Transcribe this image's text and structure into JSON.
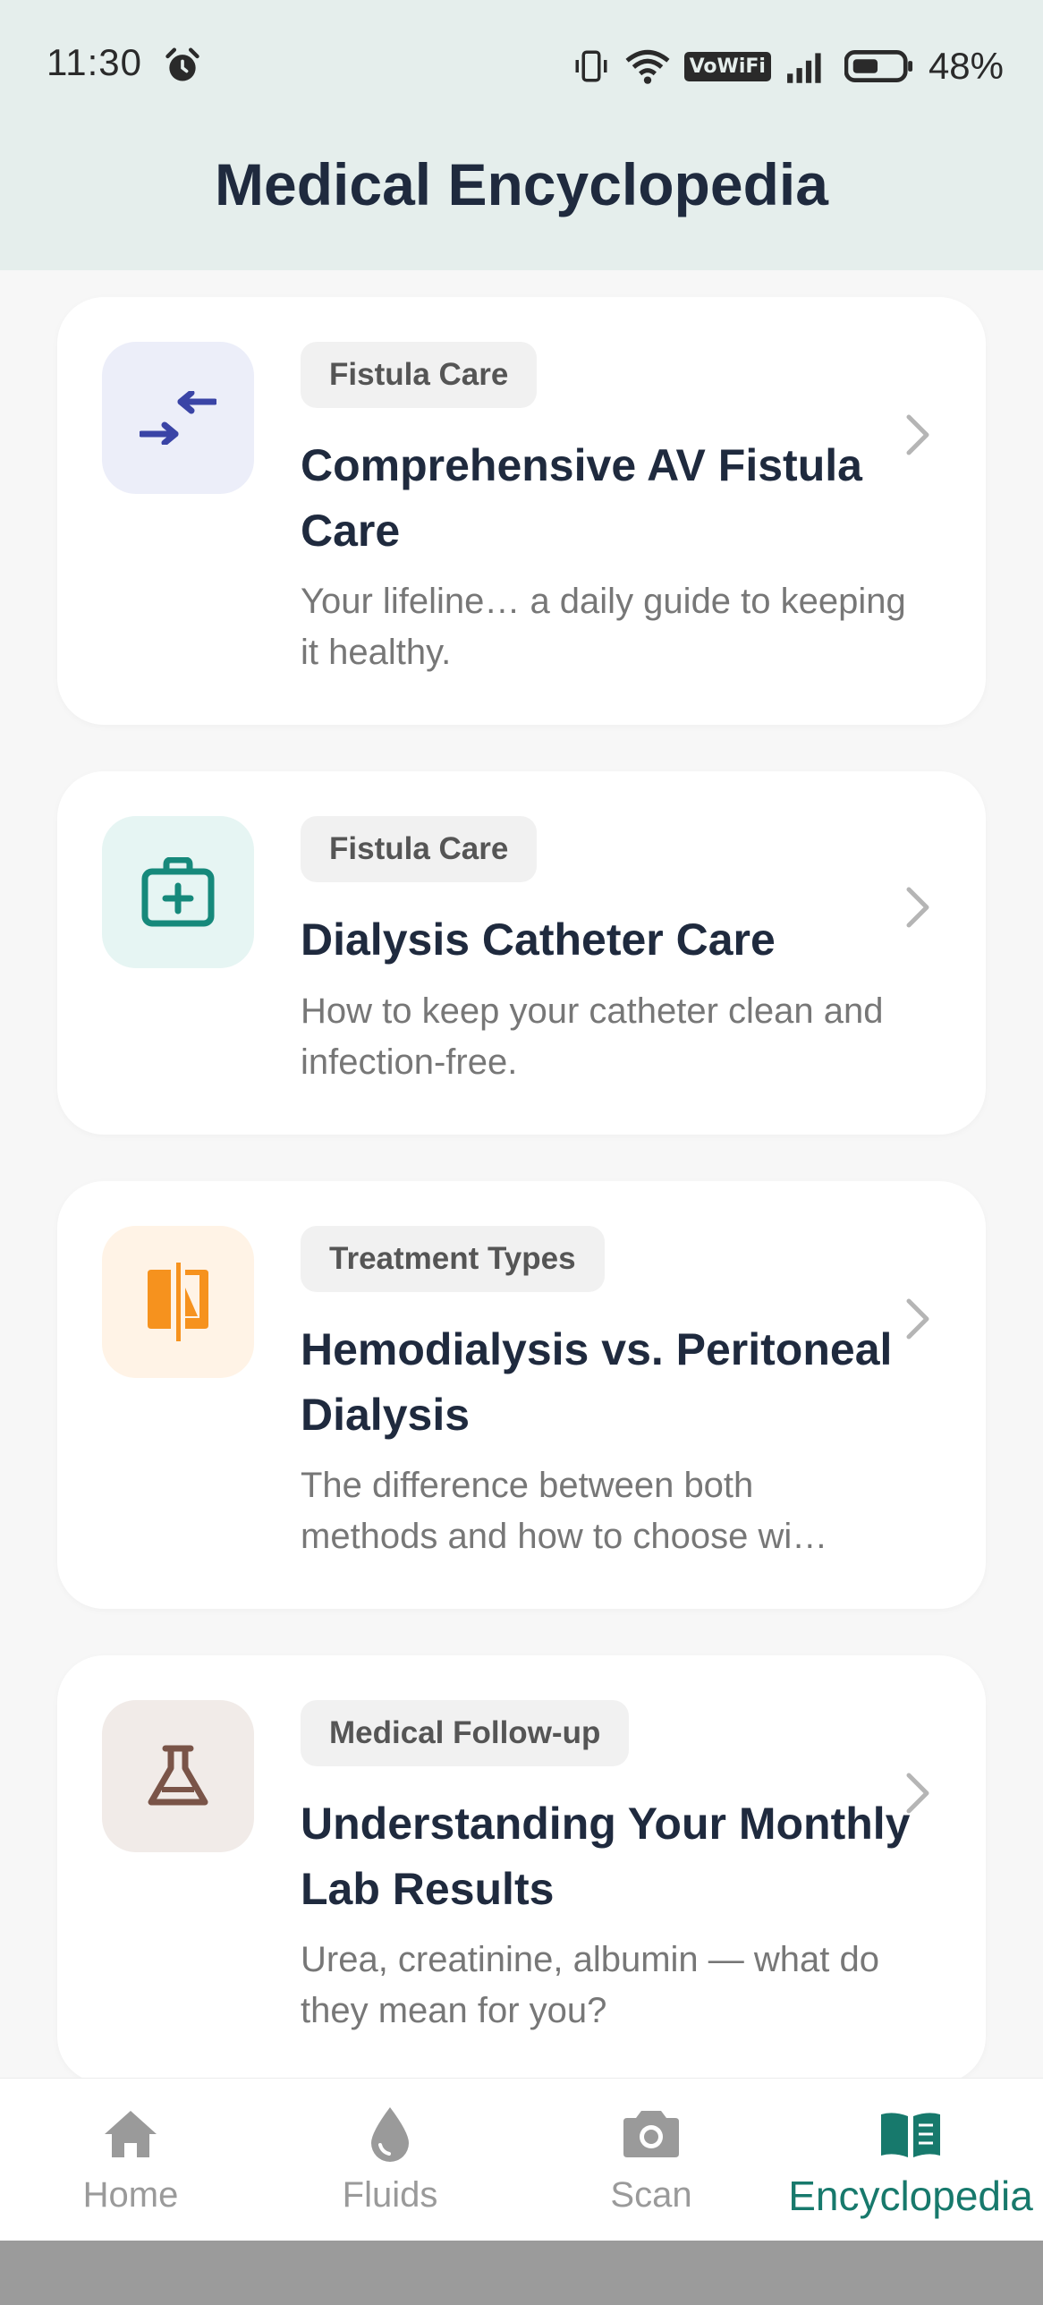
{
  "status_bar": {
    "time": "11:30",
    "wifi_badge": "VoWiFi",
    "battery_percent": "48%",
    "icons": [
      "alarm-icon",
      "vibrate-icon",
      "wifi-icon",
      "signal-icon",
      "battery-icon"
    ]
  },
  "header": {
    "title": "Medical Encyclopedia"
  },
  "articles": [
    {
      "tag": "Fistula Care",
      "title": "Comprehensive AV Fistula Care",
      "description": "Your lifeline… a daily guide to keeping it healthy.",
      "icon": "compress-arrows-icon",
      "icon_color": "#3a44a6",
      "icon_bg": "#eceef9"
    },
    {
      "tag": "Fistula Care",
      "title": "Dialysis Catheter Care",
      "description": "How to keep your catheter clean and infection-free.",
      "icon": "medical-kit-icon",
      "icon_color": "#16897b",
      "icon_bg": "#e6f5f3"
    },
    {
      "tag": "Treatment Types",
      "title": "Hemodialysis vs. Peritoneal Dialysis",
      "description_line1": "The difference between both",
      "description_line2": "methods and how to choose wi…",
      "icon": "compare-icon",
      "icon_color": "#f6921e",
      "icon_bg": "#fff3e6"
    },
    {
      "tag": "Medical Follow-up",
      "title": "Understanding Your Monthly Lab Results",
      "description": "Urea, creatinine, albumin — what do they mean for you?",
      "icon": "flask-icon",
      "icon_color": "#7a5448",
      "icon_bg": "#f1ebe8"
    }
  ],
  "bottom_nav": {
    "items": [
      {
        "label": "Home",
        "icon": "home-icon",
        "active": false
      },
      {
        "label": "Fluids",
        "icon": "water-drop-icon",
        "active": false
      },
      {
        "label": "Scan",
        "icon": "camera-icon",
        "active": false
      },
      {
        "label": "Encyclopedia",
        "icon": "book-icon",
        "active": true
      }
    ],
    "active_color": "#17796c",
    "inactive_color": "#9a9a9a"
  }
}
